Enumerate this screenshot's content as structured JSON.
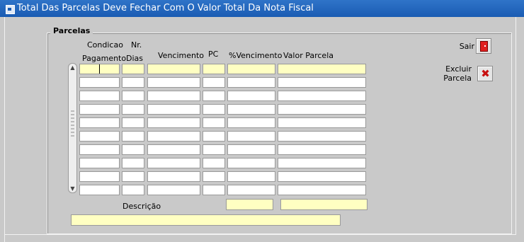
{
  "window": {
    "title": "Total Das Parcelas Deve Fechar Com O Valor Total Da Nota Fiscal"
  },
  "group": {
    "title": "Parcelas"
  },
  "columns": {
    "condicao_line1": "Condicao",
    "condicao_line2": "Pagamento",
    "dias_line1": "Nr.",
    "dias_line2": "Dias",
    "vencimento": "Vencimento",
    "pc": "PC",
    "pct_vencimento": "%Vencimento",
    "valor_parcela": "Valor Parcela"
  },
  "rows": [
    {
      "condicao": "",
      "dias": "",
      "vencimento": "",
      "pc": "",
      "pct": "",
      "valor": ""
    },
    {
      "condicao": "",
      "dias": "",
      "vencimento": "",
      "pc": "",
      "pct": "",
      "valor": ""
    },
    {
      "condicao": "",
      "dias": "",
      "vencimento": "",
      "pc": "",
      "pct": "",
      "valor": ""
    },
    {
      "condicao": "",
      "dias": "",
      "vencimento": "",
      "pc": "",
      "pct": "",
      "valor": ""
    },
    {
      "condicao": "",
      "dias": "",
      "vencimento": "",
      "pc": "",
      "pct": "",
      "valor": ""
    },
    {
      "condicao": "",
      "dias": "",
      "vencimento": "",
      "pc": "",
      "pct": "",
      "valor": ""
    },
    {
      "condicao": "",
      "dias": "",
      "vencimento": "",
      "pc": "",
      "pct": "",
      "valor": ""
    },
    {
      "condicao": "",
      "dias": "",
      "vencimento": "",
      "pc": "",
      "pct": "",
      "valor": ""
    },
    {
      "condicao": "",
      "dias": "",
      "vencimento": "",
      "pc": "",
      "pct": "",
      "valor": ""
    },
    {
      "condicao": "",
      "dias": "",
      "vencimento": "",
      "pc": "",
      "pct": "",
      "valor": ""
    }
  ],
  "footer": {
    "descricao_label": "Descrição",
    "pct_total": "",
    "valor_total": "",
    "descricao_value": ""
  },
  "buttons": {
    "sair_label": "Sair",
    "excluir_line1": "Excluir",
    "excluir_line2": "Parcela"
  },
  "icons": {
    "window": "form-icon",
    "sair": "exit-door-icon",
    "excluir": "delete-x-icon",
    "scroll_up": "arrow-up-icon",
    "scroll_down": "arrow-down-icon"
  },
  "colors": {
    "titlebar": "#1a5cb3",
    "background": "#c9c9c9",
    "current_record": "#ffffc2"
  }
}
